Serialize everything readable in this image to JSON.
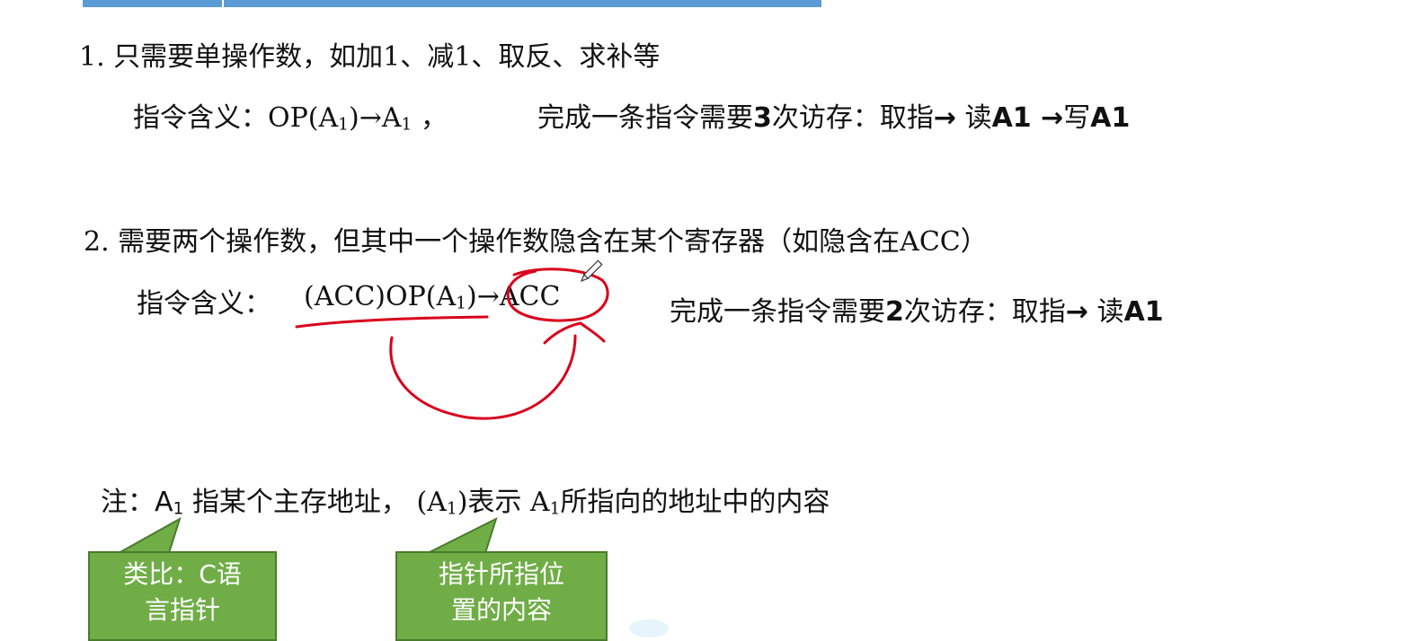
{
  "line1": {
    "text": "1. 只需要单操作数，如加1、减1、取反、求补等",
    "meaning_label": "指令含义：",
    "meaning_op": "OP(A",
    "meaning_sub": "1",
    "meaning_arrow": ")→A",
    "meaning_sub2": "1",
    "meaning_tail": " ，",
    "access_prefix": "完成一条指令需要",
    "access_count": "3",
    "access_mid": "次访存：取指",
    "access_arrow": "→",
    "access_read": " 读",
    "access_read_bold": "A1",
    "access_arrow2": " →",
    "access_write": "写",
    "access_write_bold": "A1"
  },
  "line2": {
    "text": "2. 需要两个操作数，但其中一个操作数隐含在某个寄存器（如隐含在ACC）",
    "meaning_label": "指令含义：",
    "expr_a": "(ACC)OP(A",
    "expr_sub": "1",
    "expr_b": ")→ACC",
    "access_prefix": "完成一条指令需要",
    "access_count": "2",
    "access_mid": "次访存：取指",
    "access_arrow": "→",
    "access_read": " 读",
    "access_read_bold": "A1"
  },
  "note": {
    "prefix": "注：",
    "a1": "A",
    "a1_sub": "1",
    "mid": " 指某个主存地址，",
    "paren": "(A",
    "paren_sub": "1",
    "paren_close": ")表示 A",
    "tail_sub": "1",
    "tail": "所指向的地址中的内容"
  },
  "callouts": {
    "left_line1": "类比：C语",
    "left_line2": "言指针",
    "right_line1": "指针所指位",
    "right_line2": "置的内容"
  },
  "colors": {
    "tab_blue": "#5b9bd5",
    "callout_green": "#70ad47",
    "ink_red": "#d9001b"
  }
}
